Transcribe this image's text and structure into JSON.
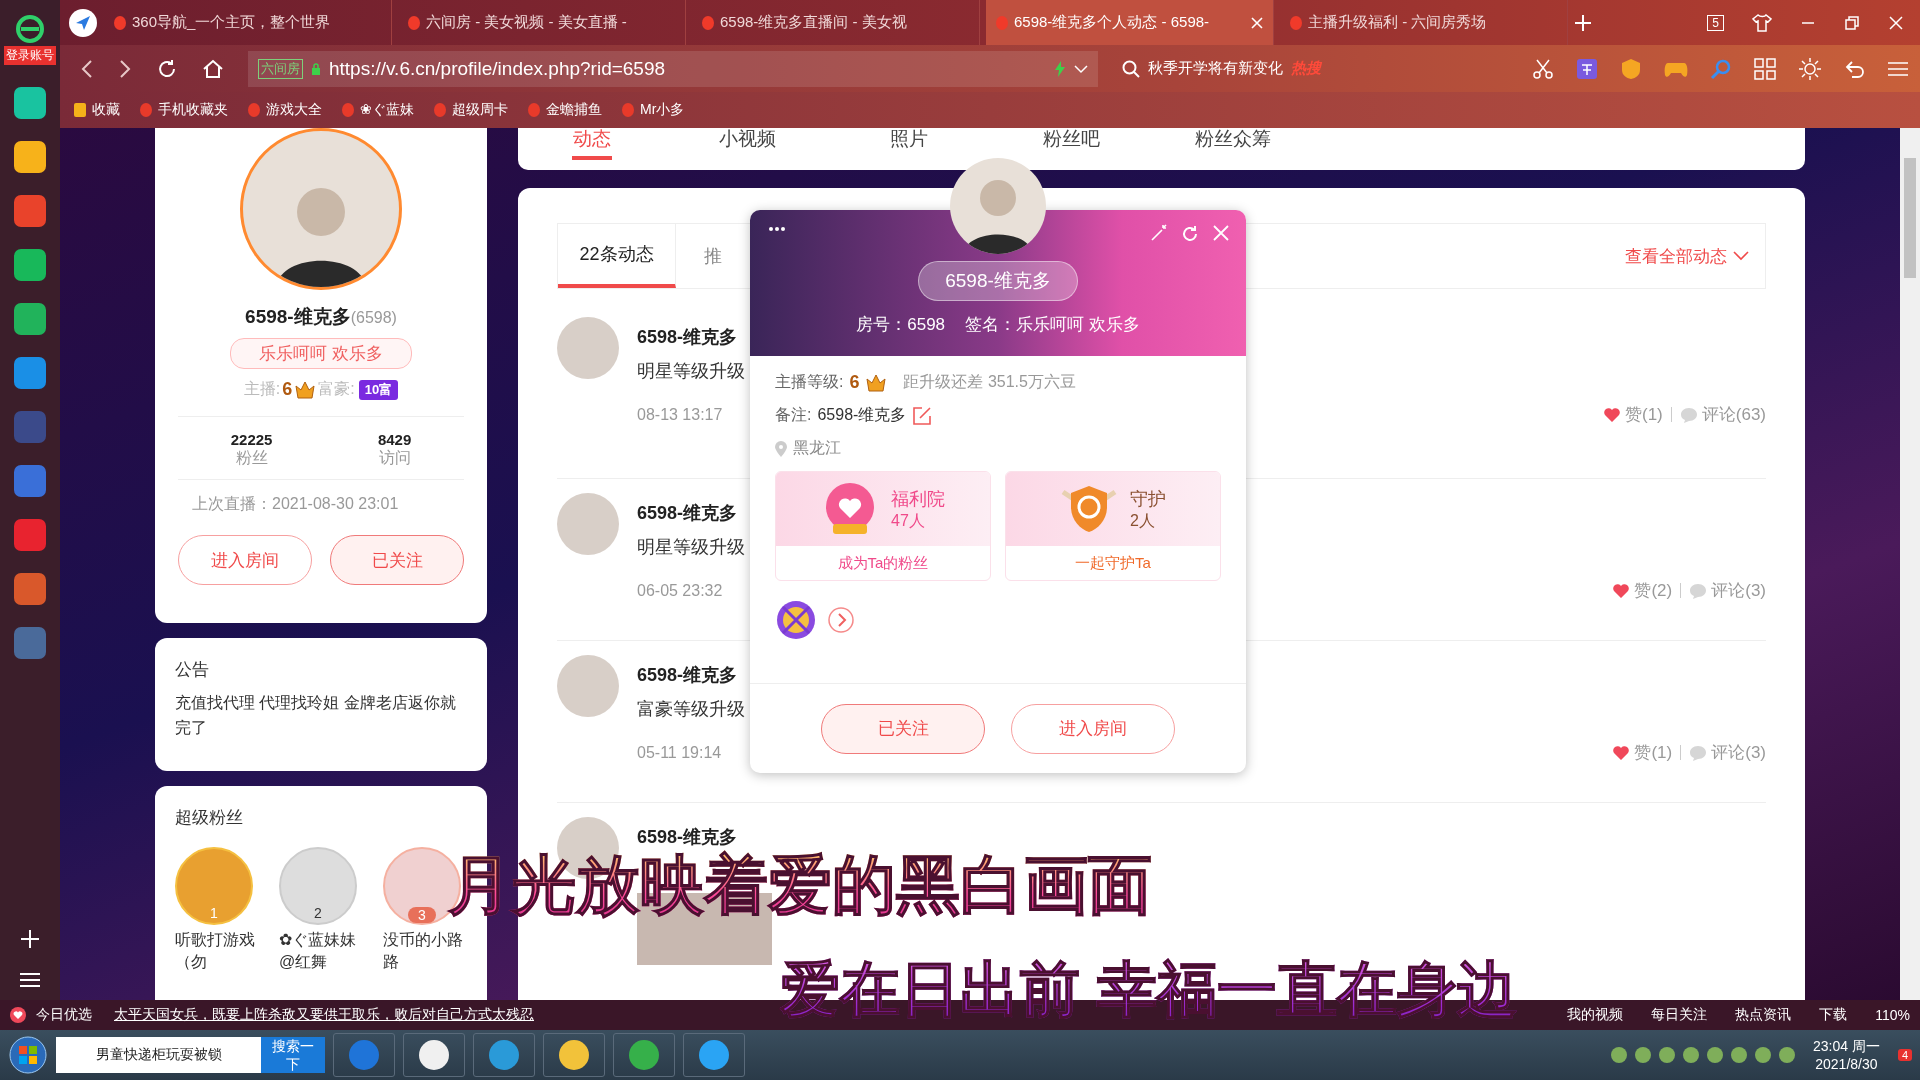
{
  "browser": {
    "login_badge": "登录账号",
    "tabs": [
      {
        "title": "360导航_一个主页，整个世界",
        "selected": false
      },
      {
        "title": "六间房 - 美女视频 - 美女直播 -",
        "selected": false
      },
      {
        "title": "6598-维克多直播间 - 美女视",
        "selected": false
      },
      {
        "title": "6598-维克多个人动态 - 6598-",
        "selected": true
      },
      {
        "title": "主播升级福利 - 六间房秀场",
        "selected": false
      }
    ],
    "tab_count": "5",
    "address_tag": "六间房",
    "address": "https://v.6.cn/profile/index.php?rid=6598",
    "search": "秋季开学将有新变化",
    "search_badge": "热搜",
    "bookmarks": [
      "收藏",
      "手机收藏夹",
      "游戏大全",
      "❀ぐ蓝妹",
      "超级周卡",
      "金蟾捕鱼",
      "Mr小多"
    ]
  },
  "nav_tabs": [
    {
      "label": "动态",
      "selected": true
    },
    {
      "label": "小视频",
      "selected": false
    },
    {
      "label": "照片",
      "selected": false
    },
    {
      "label": "粉丝吧",
      "selected": false
    },
    {
      "label": "粉丝众筹",
      "selected": false
    }
  ],
  "profile": {
    "name": "6598-维克多",
    "rid": "(6598)",
    "signature": "乐乐呵呵 欢乐多",
    "anchor_label": "主播:",
    "anchor_level": "6",
    "rich_label": "富豪:",
    "rich_badge": "10富",
    "stats": [
      {
        "value": "22225",
        "label": "粉丝"
      },
      {
        "value": "8429",
        "label": "访问"
      }
    ],
    "last_live": "上次直播：2021-08-30 23:01",
    "buttons": [
      {
        "label": "进入房间",
        "kind": "outline"
      },
      {
        "label": "已关注",
        "kind": "filled"
      }
    ]
  },
  "notice": {
    "title": "公告",
    "text": "充值找代理 代理找玲姐 金牌老店返你就完了"
  },
  "super_fans": {
    "title": "超级粉丝",
    "fans": [
      {
        "rank": "1",
        "name": "听歌打游戏（勿"
      },
      {
        "rank": "2",
        "name": "✿ぐ蓝妹妹@红舞"
      },
      {
        "rank": "3",
        "name": "没币的小路路"
      }
    ]
  },
  "feed": {
    "tabs": [
      {
        "label": "22条动态",
        "selected": true
      },
      {
        "label": "推",
        "selected": false
      }
    ],
    "view_all": "查看全部动态",
    "posts": [
      {
        "author": "6598-维克多",
        "text": "明星等级升级",
        "time": "08-13 13:17",
        "likes": "赞(1)",
        "comments": "评论(63)",
        "photo": false
      },
      {
        "author": "6598-维克多",
        "text": "明星等级升级",
        "time": "06-05 23:32",
        "likes": "赞(2)",
        "comments": "评论(3)",
        "photo": false
      },
      {
        "author": "6598-维克多",
        "text": "富豪等级升级",
        "time": "05-11 19:14",
        "likes": "赞(1)",
        "comments": "评论(3)",
        "photo": false
      },
      {
        "author": "6598-维克多",
        "photo": true
      }
    ]
  },
  "popup": {
    "name": "6598-维克多",
    "room": "房号：6598",
    "sign": "签名：乐乐呵呵 欢乐多",
    "level_label": "主播等级:",
    "level": "6",
    "upgrade": "距升级还差 351.5万六豆",
    "note_label": "备注:",
    "note": "6598-维克多",
    "location": "黑龙江",
    "cards": [
      {
        "kind": "fans",
        "title": "福利院",
        "count": "47人",
        "action": "成为Ta的粉丝"
      },
      {
        "kind": "guard",
        "title": "守护",
        "count": "2人",
        "action": "一起守护Ta"
      }
    ],
    "buttons": [
      {
        "label": "已关注",
        "kind": "filled"
      },
      {
        "label": "进入房间",
        "kind": "outline"
      }
    ]
  },
  "lyrics": [
    "月光放映着爱的黑白画面",
    "爱在日出前  幸福一直在身边"
  ],
  "status_bar": {
    "pick": "今日优选",
    "news": "太平天国女兵，既要上阵杀敌又要供王取乐，败后对自己方式太残忍",
    "items": [
      "我的视频",
      "每日关注",
      "热点资讯",
      "下载"
    ],
    "zoom": "110%"
  },
  "taskbar": {
    "search": "男童快递柜玩耍被锁",
    "search_button": "搜索一下",
    "time": "23:04 周一",
    "date": "2021/8/30",
    "badge": "4"
  }
}
